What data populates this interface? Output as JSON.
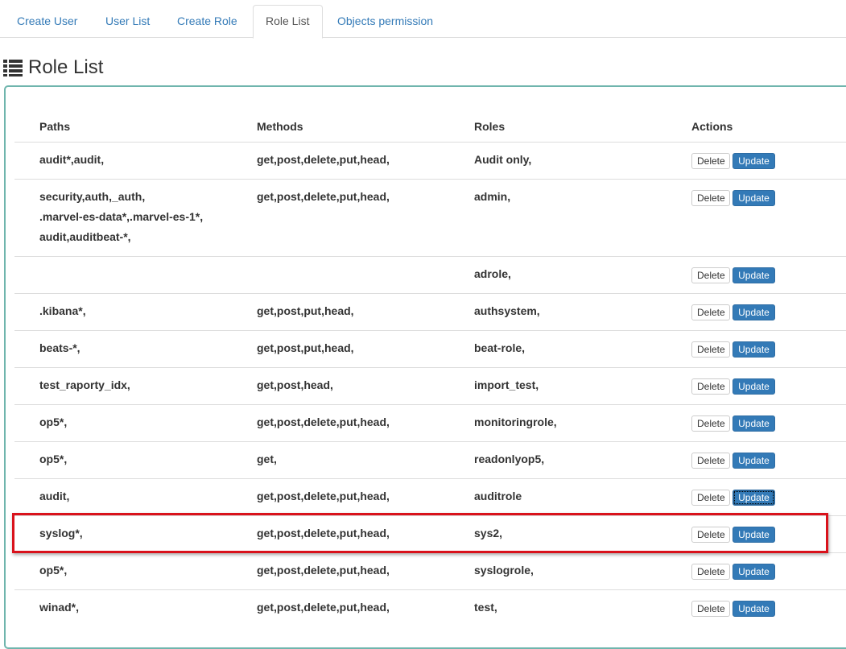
{
  "tabs": [
    {
      "label": "Create User",
      "active": false
    },
    {
      "label": "User List",
      "active": false
    },
    {
      "label": "Create Role",
      "active": false
    },
    {
      "label": "Role List",
      "active": true
    },
    {
      "label": "Objects permission",
      "active": false
    }
  ],
  "page": {
    "title": "Role List",
    "icon": "list-icon"
  },
  "table": {
    "headers": {
      "paths": "Paths",
      "methods": "Methods",
      "roles": "Roles",
      "actions": "Actions"
    },
    "delete_label": "Delete",
    "update_label": "Update",
    "rows": [
      {
        "paths": "audit*,audit,",
        "methods": "get,post,delete,put,head,",
        "roles": "Audit only,"
      },
      {
        "paths": "security,auth,_auth,\n.marvel-es-data*,.marvel-es-1*,\naudit,auditbeat-*,",
        "methods": "get,post,delete,put,head,",
        "roles": "admin,"
      },
      {
        "paths": "",
        "methods": "",
        "roles": "adrole,"
      },
      {
        "paths": ".kibana*,",
        "methods": "get,post,put,head,",
        "roles": "authsystem,"
      },
      {
        "paths": "beats-*,",
        "methods": "get,post,put,head,",
        "roles": "beat-role,"
      },
      {
        "paths": "test_raporty_idx,",
        "methods": "get,post,head,",
        "roles": "import_test,"
      },
      {
        "paths": "op5*,",
        "methods": "get,post,delete,put,head,",
        "roles": "monitoringrole,"
      },
      {
        "paths": "op5*,",
        "methods": "get,",
        "roles": "readonlyop5,"
      },
      {
        "paths": "audit,",
        "methods": "get,post,delete,put,head,",
        "roles": "auditrole"
      },
      {
        "paths": "syslog*,",
        "methods": "get,post,delete,put,head,",
        "roles": "sys2,"
      },
      {
        "paths": "op5*,",
        "methods": "get,post,delete,put,head,",
        "roles": "syslogrole,"
      },
      {
        "paths": "winad*,",
        "methods": "get,post,delete,put,head,",
        "roles": "test,"
      }
    ]
  },
  "colors": {
    "link": "#337ab7",
    "primary": "#337ab7",
    "panel_border": "#6fb5ad",
    "highlight": "#d9121b"
  }
}
